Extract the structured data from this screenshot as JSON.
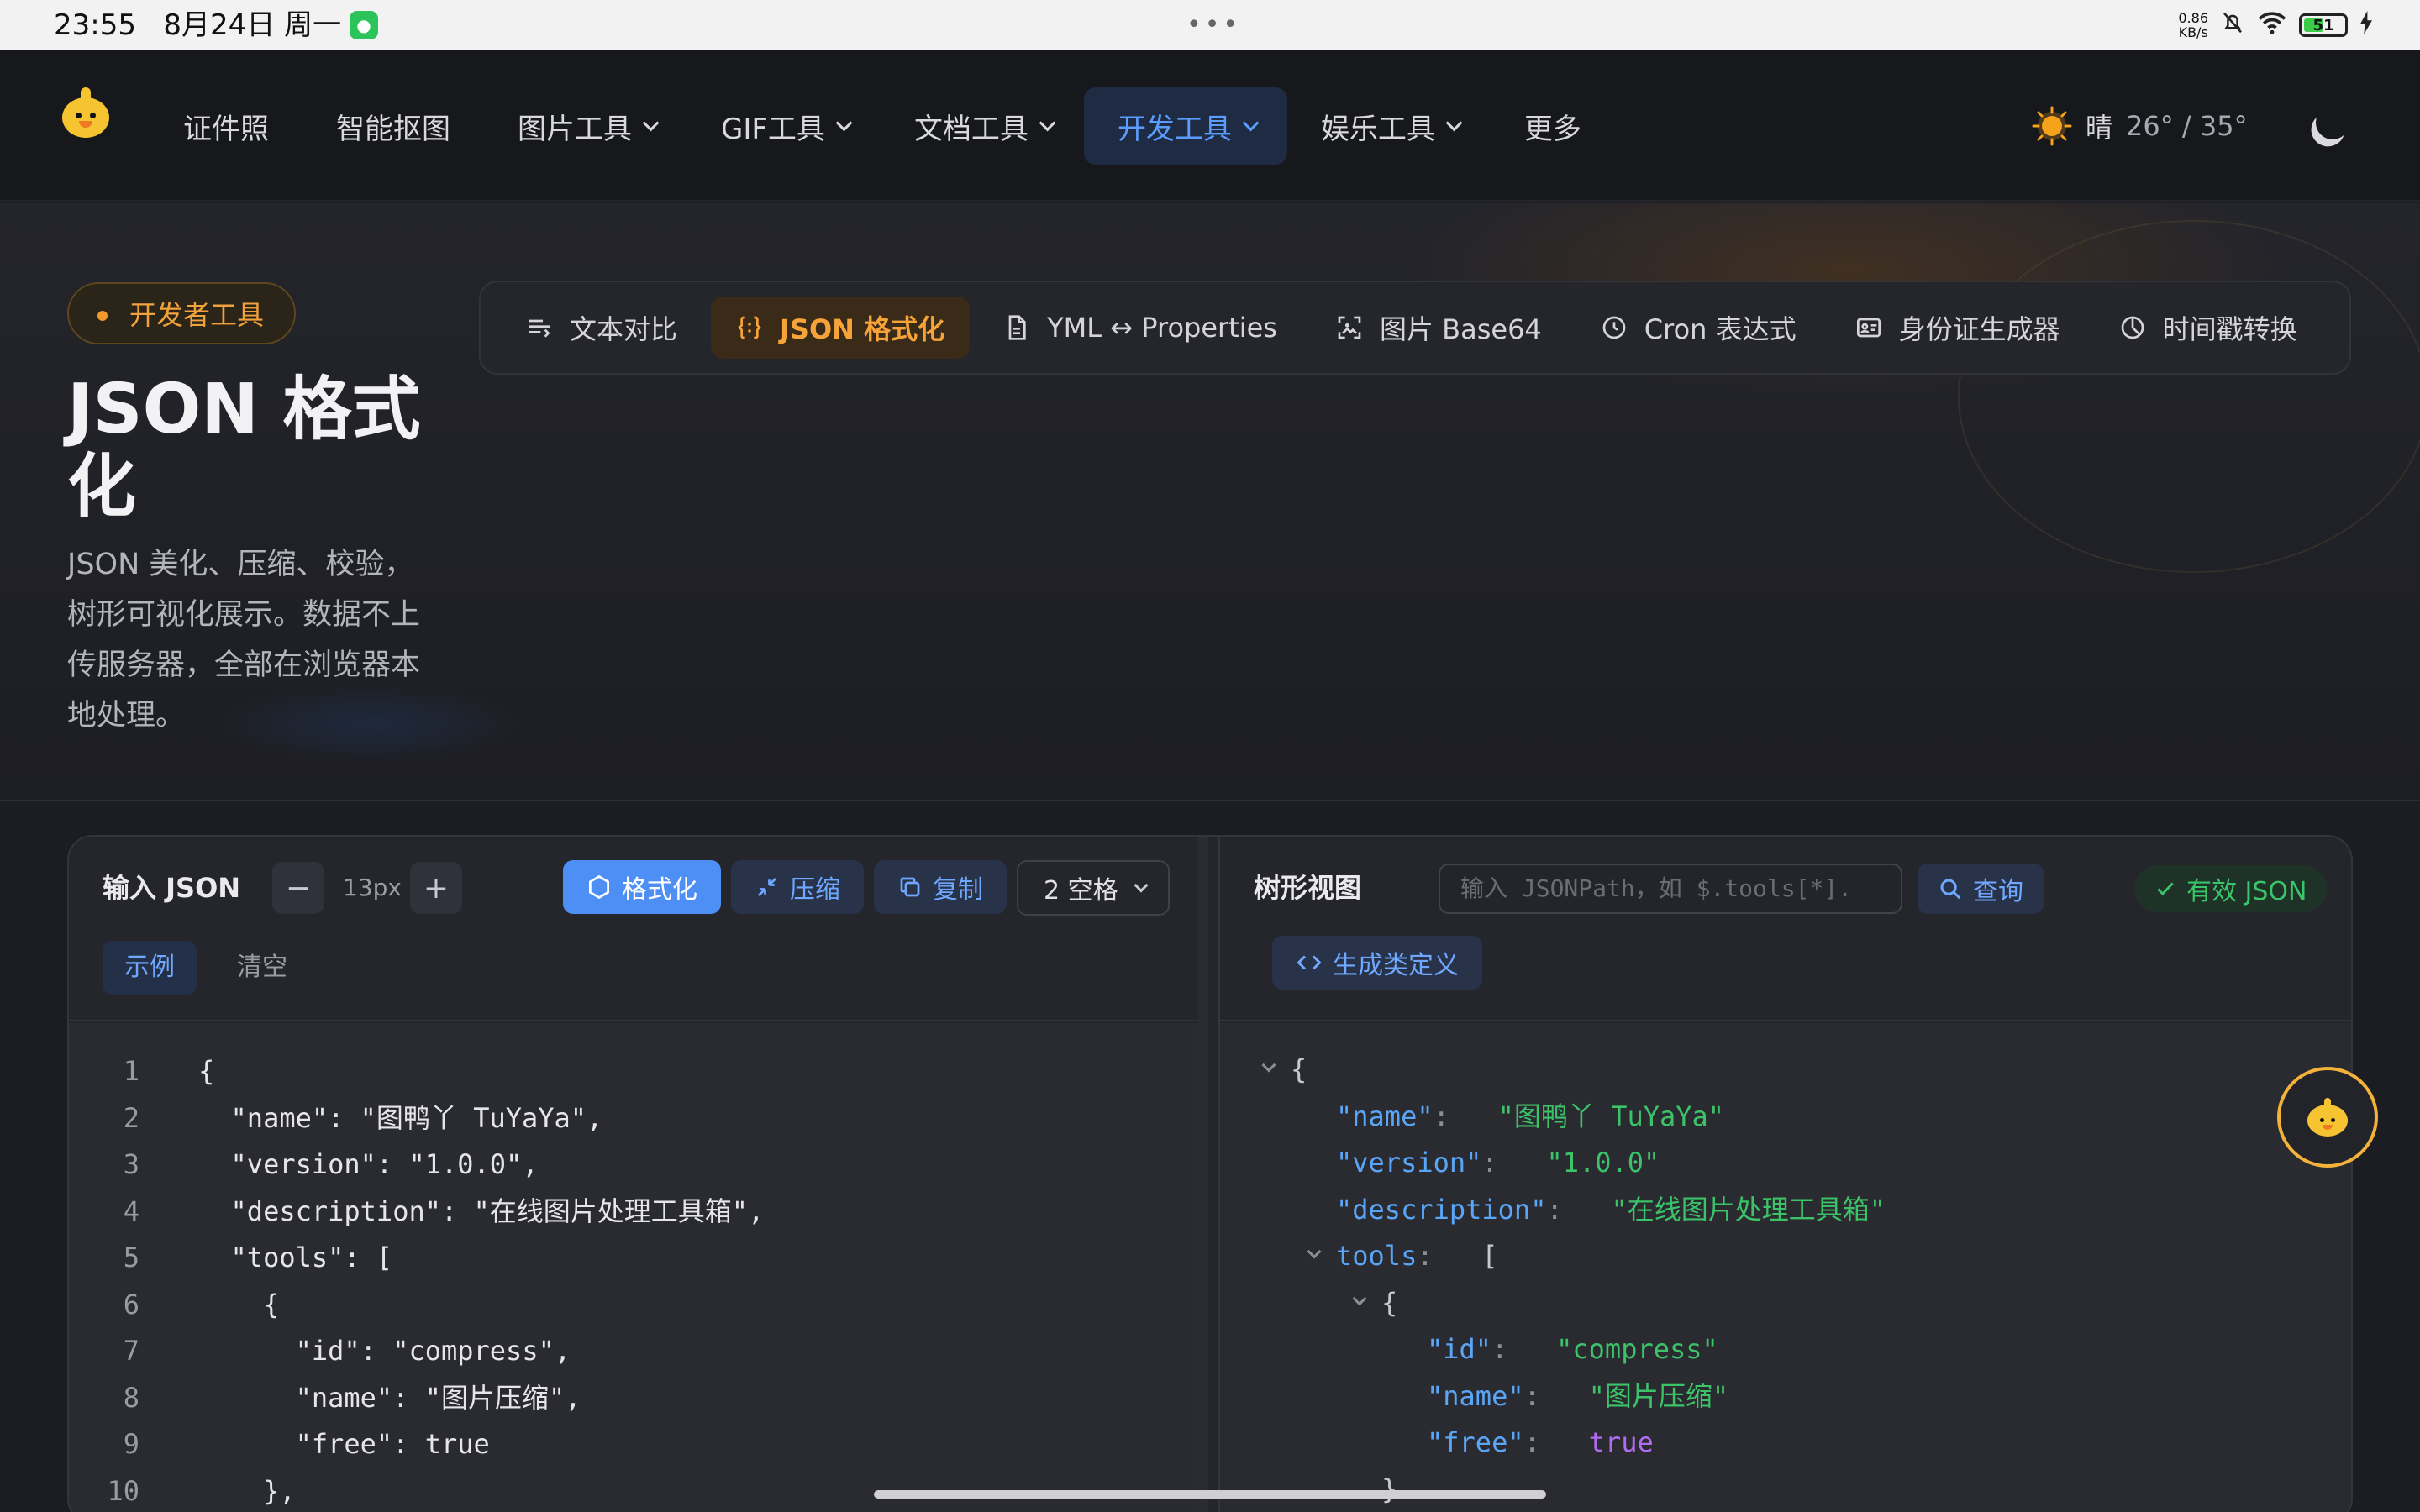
{
  "status_bar": {
    "time": "23:55",
    "date": "8月24日 周一",
    "net_speed_value": "0.86",
    "net_speed_unit": "KB/s",
    "battery": "51",
    "battery_level": 0.51
  },
  "nav": {
    "items": [
      {
        "label": "证件照",
        "dropdown": false,
        "active": false
      },
      {
        "label": "智能抠图",
        "dropdown": false,
        "active": false
      },
      {
        "label": "图片工具",
        "dropdown": true,
        "active": false
      },
      {
        "label": "GIF工具",
        "dropdown": true,
        "active": false
      },
      {
        "label": "文档工具",
        "dropdown": true,
        "active": false
      },
      {
        "label": "开发工具",
        "dropdown": true,
        "active": true
      },
      {
        "label": "娱乐工具",
        "dropdown": true,
        "active": false
      },
      {
        "label": "更多",
        "dropdown": false,
        "active": false
      }
    ],
    "weather": {
      "condition": "晴",
      "temp": "26° / 35°"
    }
  },
  "hero": {
    "badge": "开发者工具",
    "title": "JSON 格式化",
    "description": "JSON 美化、压缩、校验，树形可视化展示。数据不上传服务器，全部在浏览器本地处理。"
  },
  "tool_tabs": [
    {
      "label": "文本对比",
      "icon": "text-diff-icon",
      "active": false
    },
    {
      "label": "JSON 格式化",
      "icon": "braces-icon",
      "active": true
    },
    {
      "label": "YML ↔ Properties",
      "icon": "file-icon",
      "active": false
    },
    {
      "label": "图片 Base64",
      "icon": "image-scan-icon",
      "active": false
    },
    {
      "label": "Cron 表达式",
      "icon": "clock-icon",
      "active": false
    },
    {
      "label": "身份证生成器",
      "icon": "id-card-icon",
      "active": false
    },
    {
      "label": "时间戳转换",
      "icon": "pie-clock-icon",
      "active": false
    }
  ],
  "input_pane": {
    "title": "输入 JSON",
    "font_size": "13px",
    "buttons": {
      "format": "格式化",
      "compress": "压缩",
      "copy": "复制"
    },
    "indent": "2 空格",
    "chips": {
      "example": "示例",
      "clear": "清空"
    },
    "lines": [
      {
        "n": "1",
        "text": "{"
      },
      {
        "n": "2",
        "text": "  \"name\": \"图鸭丫 TuYaYa\","
      },
      {
        "n": "3",
        "text": "  \"version\": \"1.0.0\","
      },
      {
        "n": "4",
        "text": "  \"description\": \"在线图片处理工具箱\","
      },
      {
        "n": "5",
        "text": "  \"tools\": ["
      },
      {
        "n": "6",
        "text": "    {"
      },
      {
        "n": "7",
        "text": "      \"id\": \"compress\","
      },
      {
        "n": "8",
        "text": "      \"name\": \"图片压缩\","
      },
      {
        "n": "9",
        "text": "      \"free\": true"
      },
      {
        "n": "10",
        "text": "    },"
      }
    ]
  },
  "tree_pane": {
    "title": "树形视图",
    "jsonpath_placeholder": "输入 JSONPath，如 $.tools[*].",
    "query": "查询",
    "valid": "有效 JSON",
    "generate": "生成类定义",
    "nodes": [
      {
        "open": "{"
      },
      {
        "key": "\"name\"",
        "value": "\"图鸭丫 TuYaYa\""
      },
      {
        "key": "\"version\"",
        "value": "\"1.0.0\""
      },
      {
        "key": "\"description\"",
        "value": "\"在线图片处理工具箱\""
      },
      {
        "key": "tools",
        "open": "["
      },
      {
        "open": "{"
      },
      {
        "key": "\"id\"",
        "value": "\"compress\""
      },
      {
        "key": "\"name\"",
        "value": "\"图片压缩\""
      },
      {
        "key": "\"free\"",
        "value": "true"
      },
      {
        "close": "}"
      }
    ]
  },
  "colors": {
    "accent_blue": "#4e8ff6",
    "accent_orange": "#f6a33a",
    "json_key": "#5aa5f5",
    "json_string": "#3cc268",
    "json_bool": "#b06cf0"
  }
}
